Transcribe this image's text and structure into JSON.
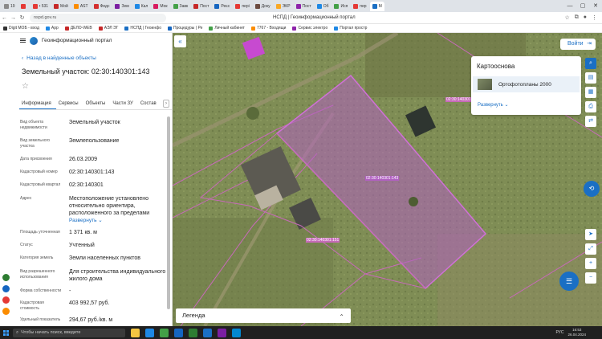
{
  "browser": {
    "tabs": [
      {
        "label": "19",
        "color": "#8a8a8a"
      },
      {
        "label": "",
        "color": "#e53935"
      },
      {
        "label": "• 531",
        "color": "#e53935"
      },
      {
        "label": "Мой",
        "color": "#c62828"
      },
      {
        "label": "AST",
        "color": "#fb8c00"
      },
      {
        "label": "Федс",
        "color": "#d32f2f"
      },
      {
        "label": "Зем",
        "color": "#7b1fa2"
      },
      {
        "label": "Кал",
        "color": "#1e88e5"
      },
      {
        "label": "Мок",
        "color": "#d81b60"
      },
      {
        "label": "Завк",
        "color": "#43a047"
      },
      {
        "label": "Пост",
        "color": "#c62828"
      },
      {
        "label": "Реєс",
        "color": "#1565c0"
      },
      {
        "label": "пері",
        "color": "#e53935"
      },
      {
        "label": "Доку",
        "color": "#6d4c41"
      },
      {
        "label": "ЭКР",
        "color": "#f9a825"
      },
      {
        "label": "Пост",
        "color": "#8e24aa"
      },
      {
        "label": "Об",
        "color": "#1e88e5"
      },
      {
        "label": "Ися",
        "color": "#43a047"
      },
      {
        "label": "пер",
        "color": "#e53935"
      },
      {
        "label": "М",
        "color": "#1a6fc4",
        "active": true
      }
    ],
    "url": "nspd.gov.ru",
    "page_title": "НСПД | Геоинформационный портал",
    "bookmarks": [
      {
        "label": "Digit МОБ - вход",
        "color": "#333"
      },
      {
        "label": "App",
        "color": "#1e88e5"
      },
      {
        "label": "ДЕЛО-WEB",
        "color": "#c62828"
      },
      {
        "label": "АЭЛ ЭГ",
        "color": "#c62828"
      },
      {
        "label": "НСПД | Геоинфо",
        "color": "#1a6fc4"
      },
      {
        "label": "Процедуры | Ре",
        "color": "#1565c0"
      },
      {
        "label": "Личный кабинет",
        "color": "#43a047"
      },
      {
        "label": "7767 - Входящи",
        "color": "#fb8c00"
      },
      {
        "label": "Сервис электро",
        "color": "#8e24aa"
      },
      {
        "label": "Портал простр",
        "color": "#1e88e5"
      }
    ]
  },
  "panel": {
    "portal_title": "Геоинформационный портал",
    "back_label": "Назад в найденные объекты",
    "object_title": "Земельный участок: 02:30:140301:143",
    "tabs": [
      "Информация",
      "Сервисы",
      "Объекты",
      "Части ЗУ",
      "Состав"
    ],
    "attributes": [
      {
        "label": "Вид объекта недвижимости",
        "value": "Земельный участок"
      },
      {
        "label": "Вид земельного участка",
        "value": "Землепользование"
      },
      {
        "label": "Дата присвоения",
        "value": "26.03.2009"
      },
      {
        "label": "Кадастровый номер",
        "value": "02:30:140301:143"
      },
      {
        "label": "Кадастровый квартал",
        "value": "02:30:140301"
      },
      {
        "label": "Адрес",
        "value": "Местоположение установлено относительно ориентира, расположенного за пределами",
        "link": "Развернуть"
      },
      {
        "label": "Площадь уточненная",
        "value": "1 371 кв. м"
      },
      {
        "label": "Статус",
        "value": "Учтенный"
      },
      {
        "label": "Категория земель",
        "value": "Земли населенных пунктов"
      },
      {
        "label": "Вид разрешенного использования",
        "value": "Для строительства индивидуального жилого дома"
      },
      {
        "label": "Форма собственности",
        "value": "-"
      },
      {
        "label": "Кадастровая стоимость",
        "value": "403 992,57 руб."
      },
      {
        "label": "Удельный показатель",
        "value": "294,67 руб./кв. м"
      }
    ]
  },
  "map": {
    "login_label": "Войти",
    "basemap_title": "Картооснова",
    "basemap_item": "Ортофотопланы 2000",
    "expand_label": "Развернуть",
    "legend_label": "Легенда",
    "parcel_label_main": "02:30:140301:143",
    "parcel_label_left": "02:30:140301:151",
    "parcel_label_top": "02:30:140301",
    "accent": "#1a6fc4",
    "parcel_fill": "#b060c0"
  },
  "taskbar": {
    "search_placeholder": "Чтобы начать поиск, введите",
    "time": "16:53",
    "date": "26.04.2024",
    "lang": "РУС"
  }
}
